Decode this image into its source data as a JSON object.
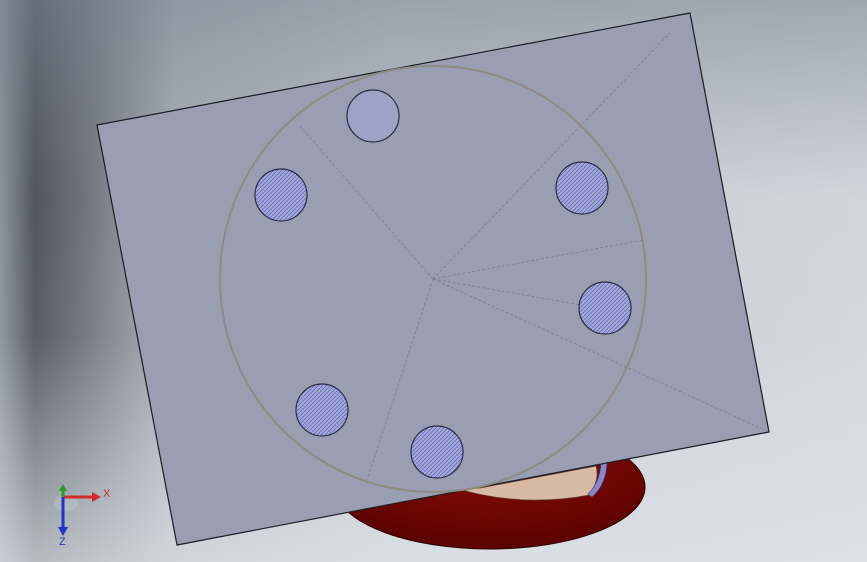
{
  "scene": {
    "background_top": "#7f878f",
    "background_bottom": "#dfe4e9",
    "plate_color": "#9a9eb3",
    "plate_edge_color": "#1b1c22",
    "flange_color": "#6e0500",
    "inner_face_color": "#d8b9a3",
    "bolt_hole_color": "#a2a6d6",
    "hatch_color": "#4b50a8",
    "construction_line_color": "#7d7e88",
    "pitch_circle_color": "#8d8c80"
  },
  "triad": {
    "x_label": "X",
    "y_label": "Y",
    "z_label": "Z",
    "x_color": "#d12b2b",
    "y_color": "#28a028",
    "z_color": "#2233c8"
  }
}
